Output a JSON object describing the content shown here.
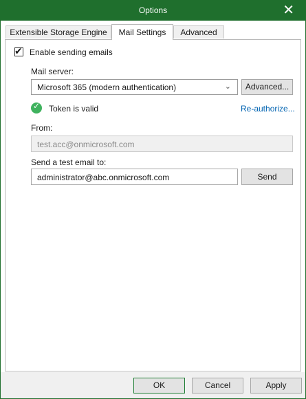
{
  "window": {
    "title": "Options"
  },
  "tabs": [
    {
      "label": "Extensible Storage Engine"
    },
    {
      "label": "Mail Settings"
    },
    {
      "label": "Advanced"
    }
  ],
  "mail": {
    "enable_label": "Enable sending emails",
    "enable_checked": true,
    "server_label": "Mail server:",
    "server_value": "Microsoft 365 (modern authentication)",
    "advanced_button": "Advanced...",
    "token_status": "Token is valid",
    "reauthorize_link": "Re-authorize...",
    "from_label": "From:",
    "from_value": "test.acc@onmicrosoft.com",
    "test_label": "Send a test email to:",
    "test_value": "administrator@abc.onmicrosoft.com",
    "send_button": "Send"
  },
  "footer": {
    "ok": "OK",
    "cancel": "Cancel",
    "apply": "Apply"
  },
  "colors": {
    "titlebar": "#1f6f2d",
    "link": "#0063b1",
    "valid": "#3fb25e"
  },
  "icons": {
    "close": "close-icon",
    "checkbox": "checkmark-icon",
    "dropdown": "chevron-down-icon",
    "status": "check-circle-icon"
  }
}
